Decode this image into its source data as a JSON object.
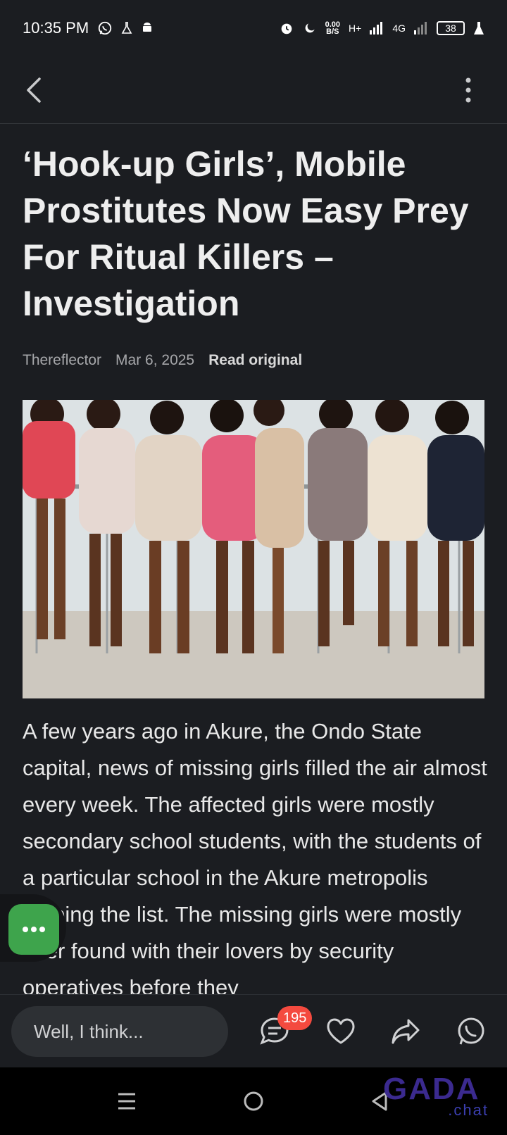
{
  "status_bar": {
    "time": "10:35 PM",
    "net_speed": "0.00",
    "net_unit": "B/S",
    "signal1": "H+",
    "signal2": "4G",
    "battery": "38",
    "icons": [
      "whatsapp-icon",
      "flask-icon",
      "android-icon",
      "alarm-icon",
      "moon-icon",
      "signal-icon",
      "battery-icon"
    ]
  },
  "article": {
    "title": "‘Hook-up Girls’, Mobile Prostitutes Now Easy Prey For Ritual Killers – Investigation",
    "source": "Thereflector",
    "date": "Mar 6, 2025",
    "read_original": "Read original",
    "body": "A few years ago in Akure, the Ondo State capital, news of missing girls filled the air almost every week. The affected girls were mostly secondary school students, with the students of a particular school in the Akure metropolis topping the list. The missing girls were mostly later found with their lovers by security operatives before they"
  },
  "bottom_bar": {
    "comment_placeholder": "Well, I think...",
    "comment_count": "195"
  },
  "watermark": {
    "brand": "GADA",
    "sub": ".chat"
  },
  "colors": {
    "background": "#1b1d21",
    "fab": "#3ea44c",
    "badge": "#f44a3f",
    "nav": "#000000"
  }
}
